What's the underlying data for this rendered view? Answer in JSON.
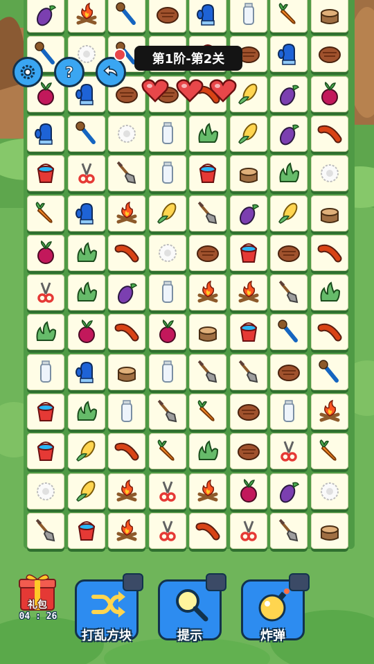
{
  "level": {
    "title": "第1阶-第2关"
  },
  "lives": 3,
  "gift": {
    "label": "礼包",
    "timer": "04 : 26"
  },
  "actions": [
    {
      "id": "shuffle",
      "label": "打乱方块",
      "icon": "shuffle-icon"
    },
    {
      "id": "hint",
      "label": "提示",
      "icon": "magnifier-icon"
    },
    {
      "id": "bomb",
      "label": "炸弹",
      "icon": "bomb-icon"
    }
  ],
  "top_buttons": [
    {
      "id": "settings",
      "icon": "gear-icon"
    },
    {
      "id": "help",
      "icon": "question-icon"
    },
    {
      "id": "undo",
      "icon": "undo-arrow-icon"
    }
  ],
  "colors": {
    "accent": "#2d8cf0",
    "board": "#4f9a45",
    "tile": "#fffde6",
    "banner": "#141414",
    "heart": "#e8474a"
  },
  "board": {
    "rows": 14,
    "cols": 8,
    "tiles": [
      [
        "eggplant",
        "campfire",
        "matchstick",
        "steak",
        "glove",
        "milk",
        "carrot",
        "stump"
      ],
      [
        "matchstick",
        "flower",
        "matchstick",
        "steak",
        "bucket",
        "steak",
        "glove",
        "steak"
      ],
      [
        "beet",
        "glove",
        "steak",
        "steak",
        "sausage",
        "corn",
        "eggplant",
        "beet"
      ],
      [
        "glove",
        "matchstick",
        "flower",
        "milk",
        "bush",
        "corn",
        "eggplant",
        "sausage"
      ],
      [
        "bucket",
        "scissors",
        "shovel",
        "milk",
        "bucket",
        "stump",
        "bush",
        "flower"
      ],
      [
        "carrot",
        "glove",
        "campfire",
        "corn",
        "shovel",
        "eggplant",
        "corn",
        "stump"
      ],
      [
        "beet",
        "bush",
        "sausage",
        "flower",
        "steak",
        "bucket",
        "steak",
        "sausage"
      ],
      [
        "scissors",
        "bush",
        "eggplant",
        "milk",
        "campfire",
        "campfire",
        "shovel",
        "bush"
      ],
      [
        "bush",
        "beet",
        "sausage",
        "beet",
        "stump",
        "bucket",
        "matchstick",
        "sausage"
      ],
      [
        "milk",
        "glove",
        "stump",
        "milk",
        "shovel",
        "shovel",
        "steak",
        "matchstick"
      ],
      [
        "bucket",
        "bush",
        "milk",
        "shovel",
        "carrot",
        "steak",
        "milk",
        "campfire"
      ],
      [
        "bucket",
        "corn",
        "sausage",
        "carrot",
        "bush",
        "steak",
        "scissors",
        "carrot"
      ],
      [
        "flower",
        "corn",
        "campfire",
        "scissors",
        "campfire",
        "beet",
        "eggplant",
        "flower"
      ],
      [
        "shovel",
        "bucket",
        "campfire",
        "scissors",
        "sausage",
        "scissors",
        "shovel",
        "stump"
      ]
    ]
  }
}
